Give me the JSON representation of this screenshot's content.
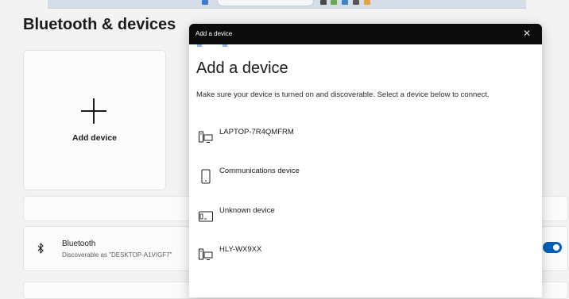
{
  "settings": {
    "title": "Bluetooth & devices",
    "add_device_label": "Add device",
    "bluetooth_title": "Bluetooth",
    "bluetooth_subtitle": "Discoverable as \"DESKTOP-A1VIGF7\"",
    "bluetooth_toggle_on": true
  },
  "dialog": {
    "window_title": "Add a device",
    "close_glyph": "✕",
    "heading": "Add a device",
    "description": "Make sure your device is turned on and discoverable. Select a device below to connect.",
    "devices": [
      {
        "label": "LAPTOP-7R4QMFRM",
        "icon": "computer-icon"
      },
      {
        "label": "Communications device",
        "icon": "phone-icon"
      },
      {
        "label": "Unknown device",
        "icon": "unknown-device-icon"
      },
      {
        "label": "HLY-WX9XX",
        "icon": "computer-icon"
      }
    ]
  },
  "colors": {
    "accent": "#005fb8",
    "dialog_titlebar": "#0c0c0c",
    "page_background": "#f3f3f3"
  }
}
